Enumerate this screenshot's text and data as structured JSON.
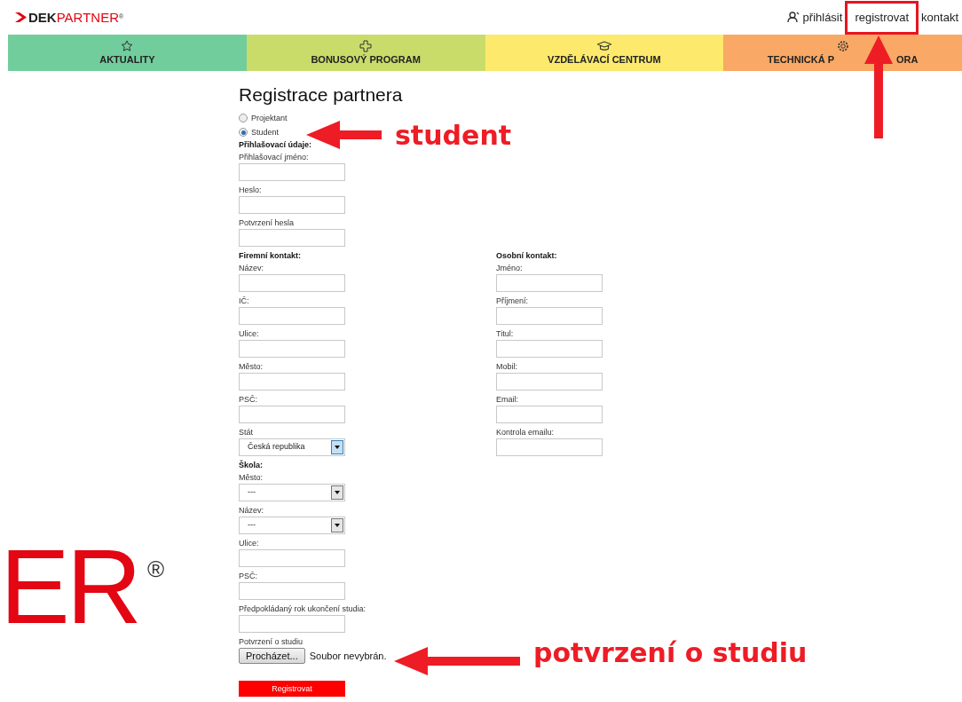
{
  "header": {
    "logo": {
      "bold": "DEK",
      "light": "PARTNER",
      "mark": "®"
    },
    "links": [
      {
        "label": "přihlásit",
        "kind": "login",
        "highlighted": false
      },
      {
        "label": "registrovat",
        "kind": "text",
        "highlighted": true
      },
      {
        "label": "kontakt",
        "kind": "text",
        "highlighted": false
      }
    ]
  },
  "nav": [
    {
      "label": "AKTUALITY",
      "kind": "star",
      "color": "#72cd9c"
    },
    {
      "label": "BONUSOVÝ PROGRAM",
      "kind": "plus",
      "color": "#c9dc6a"
    },
    {
      "label": "VZDĚLÁVACÍ CENTRUM",
      "kind": "cap",
      "color": "#fde96b"
    },
    {
      "label": "TECHNICKÁ P",
      "label_after_arrow": "ORA",
      "kind": "gear",
      "color": "#f9a865"
    }
  ],
  "background_logo": {
    "letters": "ER",
    "mark": "®"
  },
  "form": {
    "title": "Registrace partnera",
    "roles": [
      {
        "label": "Projektant",
        "selected": false
      },
      {
        "label": "Student",
        "selected": true
      }
    ],
    "login": {
      "heading": "Přihlašovací údaje:",
      "fields": [
        {
          "label": "Přihlašovací jméno:",
          "kind": "text"
        },
        {
          "label": "Heslo:",
          "kind": "text"
        },
        {
          "label": "Potvrzení hesla",
          "kind": "text"
        }
      ]
    },
    "company": {
      "heading": "Firemní kontakt:",
      "fields": [
        {
          "label": "Název:",
          "kind": "text"
        },
        {
          "label": "IČ:",
          "kind": "text"
        },
        {
          "label": "Ulice:",
          "kind": "text"
        },
        {
          "label": "Město:",
          "kind": "text"
        },
        {
          "label": "PSČ:",
          "kind": "text"
        },
        {
          "label": "Stát",
          "kind": "select",
          "value": "Česká republika",
          "focused": true
        }
      ]
    },
    "personal": {
      "heading": "Osobní kontakt:",
      "fields": [
        {
          "label": "Jméno:",
          "kind": "text"
        },
        {
          "label": "Příjmení:",
          "kind": "text"
        },
        {
          "label": "Titul:",
          "kind": "text"
        },
        {
          "label": "Mobil:",
          "kind": "text"
        },
        {
          "label": "Email:",
          "kind": "text"
        },
        {
          "label": "Kontrola emailu:",
          "kind": "text"
        }
      ]
    },
    "school": {
      "heading": "Škola:",
      "fields": [
        {
          "label": "Město:",
          "kind": "select",
          "value": "---",
          "focused": false
        },
        {
          "label": "Název:",
          "kind": "select",
          "value": "---",
          "focused": false
        },
        {
          "label": "Ulice:",
          "kind": "text"
        },
        {
          "label": "PSČ:",
          "kind": "text"
        },
        {
          "label": "Předpokládaný rok ukončení studia:",
          "kind": "text"
        }
      ]
    },
    "upload": {
      "label": "Potvrzení o studiu",
      "button": "Procházet...",
      "status": "Soubor nevybrán."
    },
    "submit": "Registrovat"
  },
  "annotations": [
    {
      "kind": "left",
      "text": "student"
    },
    {
      "kind": "left",
      "text": "potvrzení o studiu"
    },
    {
      "kind": "up"
    }
  ]
}
